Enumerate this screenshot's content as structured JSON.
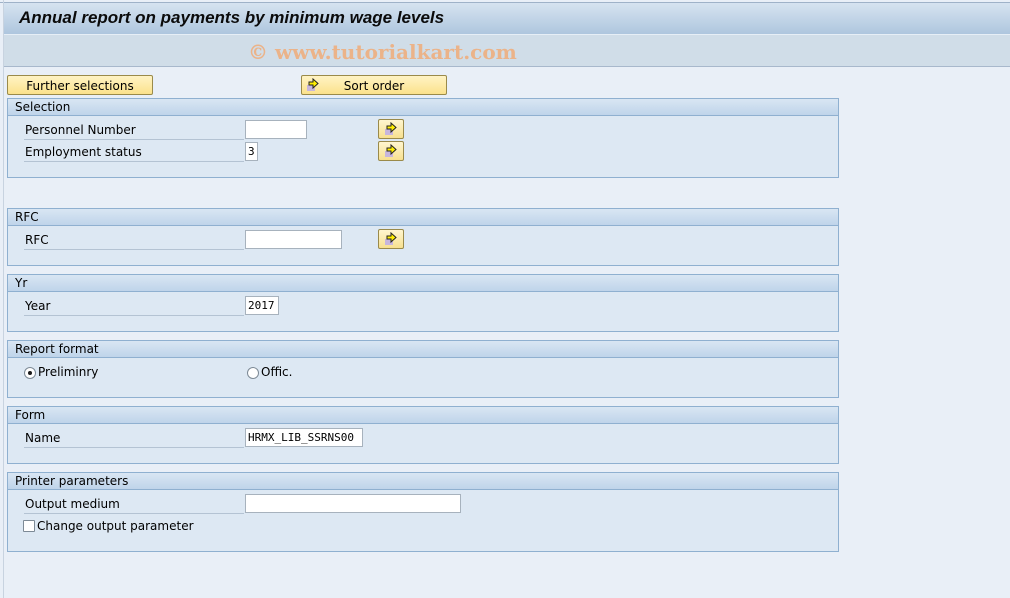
{
  "window": {
    "title": "Annual report on payments by minimum wage levels",
    "watermark": "© www.tutorialkart.com"
  },
  "toolbar": {
    "further_selections_label": "Further selections",
    "sort_order_label": "Sort order"
  },
  "groups": {
    "selection": {
      "title": "Selection",
      "personnel_number": {
        "label": "Personnel Number",
        "value": ""
      },
      "employment_status": {
        "label": "Employment status",
        "value": "3"
      }
    },
    "rfc": {
      "title": "RFC",
      "rfc": {
        "label": "RFC",
        "value": ""
      }
    },
    "yr": {
      "title": "Yr",
      "year": {
        "label": "Year",
        "value": "2017"
      }
    },
    "report_format": {
      "title": "Report format",
      "options": [
        {
          "label": "Preliminry",
          "selected": true
        },
        {
          "label": "Offic.",
          "selected": false
        }
      ]
    },
    "form": {
      "title": "Form",
      "name": {
        "label": "Name",
        "value": "HRMX_LIB_SSRNS00"
      }
    },
    "printer_parameters": {
      "title": "Printer parameters",
      "output_medium": {
        "label": "Output medium",
        "value": ""
      },
      "change_output_parameter": {
        "label": "Change output parameter",
        "checked": false
      }
    }
  },
  "icons": {
    "multiple_selection": "arrow-right-icon"
  }
}
